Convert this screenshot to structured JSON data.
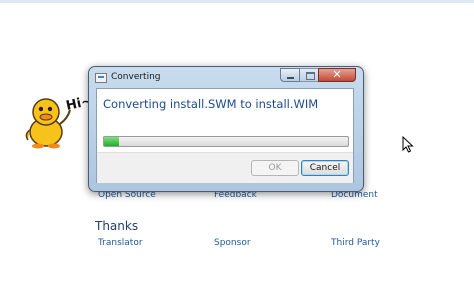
{
  "background": {
    "links_row1": [
      "Open Source",
      "Feedback",
      "Document"
    ],
    "thanks_heading": "Thanks",
    "links_row2": [
      "Translator",
      "Sponsor",
      "Third Party"
    ],
    "mascot_text": "Hi~"
  },
  "dialog": {
    "title": "Converting",
    "message": "Converting install.SWM to install.WIM",
    "progress": 0.06,
    "ok_label": "OK",
    "cancel_label": "Cancel",
    "close_glyph": "✕",
    "ok_enabled": false
  },
  "colors": {
    "link": "#1f5a9c",
    "message": "#1b4b8a",
    "progress_fill": "#1fae2f",
    "close_button": "#c24a37"
  },
  "icons": [
    "app-icon",
    "minimize-icon",
    "maximize-icon",
    "close-icon",
    "duck-mascot-logo",
    "mouse-cursor-icon"
  ]
}
